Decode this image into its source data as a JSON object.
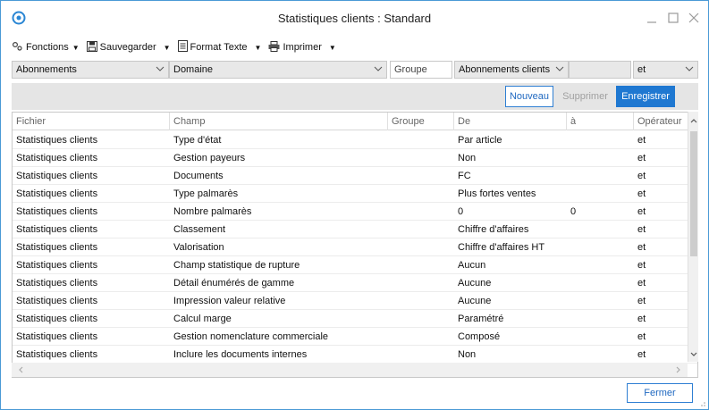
{
  "window": {
    "title": "Statistiques clients : Standard"
  },
  "toolbar": {
    "functions_label": "Fonctions",
    "save_label": "Sauvegarder",
    "format_label": "Format Texte",
    "print_label": "Imprimer"
  },
  "filters": {
    "fichier": "Abonnements",
    "champ": "Domaine",
    "groupe": "Groupe",
    "de": "Abonnements clients",
    "a": "",
    "operateur": "et"
  },
  "actions": {
    "new_label": "Nouveau",
    "delete_label": "Supprimer",
    "save_label": "Enregistrer"
  },
  "table": {
    "columns": [
      "Fichier",
      "Champ",
      "Groupe",
      "De",
      "à",
      "Opérateur"
    ],
    "rows": [
      [
        "Statistiques clients",
        "Type d'état",
        "",
        "Par article",
        "",
        "et"
      ],
      [
        "Statistiques clients",
        "Gestion payeurs",
        "",
        "Non",
        "",
        "et"
      ],
      [
        "Statistiques clients",
        "Documents",
        "",
        "FC",
        "",
        "et"
      ],
      [
        "Statistiques clients",
        "Type palmarès",
        "",
        "Plus fortes ventes",
        "",
        "et"
      ],
      [
        "Statistiques clients",
        "Nombre palmarès",
        "",
        "0",
        "0",
        "et"
      ],
      [
        "Statistiques clients",
        "Classement",
        "",
        "Chiffre d'affaires",
        "",
        "et"
      ],
      [
        "Statistiques clients",
        "Valorisation",
        "",
        "Chiffre d'affaires HT",
        "",
        "et"
      ],
      [
        "Statistiques clients",
        "Champ statistique de rupture",
        "",
        "Aucun",
        "",
        "et"
      ],
      [
        "Statistiques clients",
        "Détail énumérés de gamme",
        "",
        "Aucune",
        "",
        "et"
      ],
      [
        "Statistiques clients",
        "Impression valeur relative",
        "",
        "Aucune",
        "",
        "et"
      ],
      [
        "Statistiques clients",
        "Calcul marge",
        "",
        "Paramétré",
        "",
        "et"
      ],
      [
        "Statistiques clients",
        "Gestion nomenclature commerciale",
        "",
        "Composé",
        "",
        "et"
      ],
      [
        "Statistiques clients",
        "Inclure les documents internes",
        "",
        "Non",
        "",
        "et"
      ]
    ]
  },
  "footer": {
    "close_label": "Fermer"
  },
  "colors": {
    "accent": "#1f78d1",
    "frame": "#4a9ad6",
    "bar": "#e5e5e5"
  }
}
